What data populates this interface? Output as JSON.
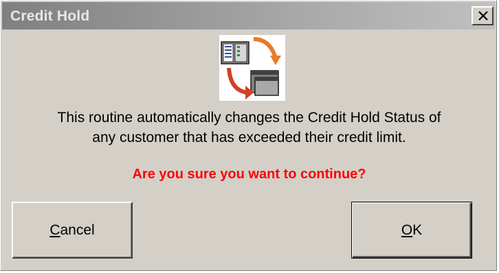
{
  "window": {
    "title": "Credit Hold",
    "close_glyph": "X"
  },
  "icon": {
    "name": "credit-hold-exchange-icon",
    "colors": {
      "arrow_orange": "#e87a2a",
      "arrow_red": "#d0402a",
      "panel_gray": "#808080",
      "panel_dark": "#404040",
      "screen_blue": "#3a4a9a",
      "screen_green": "#2e8b3a"
    }
  },
  "message": {
    "line1": "This routine automatically changes the Credit Hold Status of",
    "line2": "any customer that has exceeded their credit limit."
  },
  "warning": {
    "text": "Are you sure you want to continue?",
    "color": "#ff0000"
  },
  "buttons": {
    "cancel": {
      "hotkey": "C",
      "rest": "ancel"
    },
    "ok": {
      "hotkey": "O",
      "rest": "K"
    }
  }
}
